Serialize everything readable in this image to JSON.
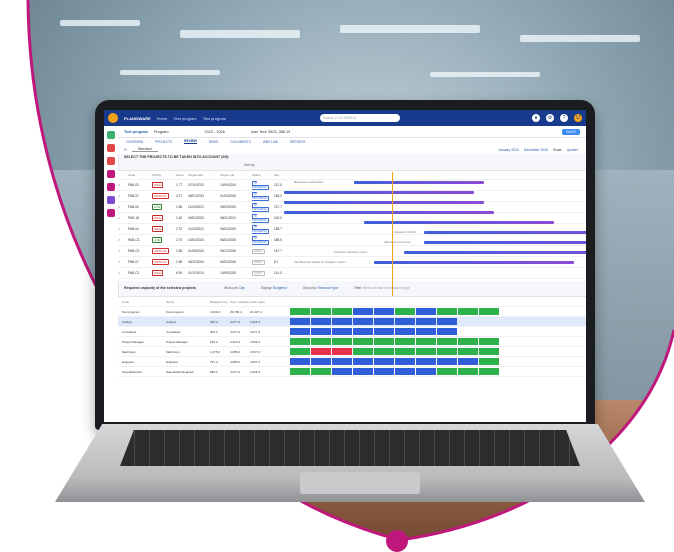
{
  "app": {
    "brand": "PLANISWARE",
    "brand_sub": "Enterprise",
    "crumbs": [
      "Home",
      "Test program",
      "Test program"
    ],
    "search_placeholder": "Search (Ctrl+Shift+K)"
  },
  "project_bar": {
    "name": "Test program",
    "type": "Program",
    "range": "2023 - 2026",
    "owner": "Ivan Tech 3523_388 19",
    "save_label": "SAVE"
  },
  "tabs": [
    "OVERVIEW",
    "PROJECTS",
    "REVIEW",
    "RISKS",
    "DOCUMENTS",
    "WBS LINK",
    "REPORTS"
  ],
  "active_tab": "REVIEW",
  "filter": {
    "label": "Standard",
    "sort_label": "Sort by",
    "scale_label": "Scale",
    "scale_value": "Quarter",
    "from_label": "January 2023",
    "to_label": "December 2026"
  },
  "selector_title": "SELECT THE PROJECTS TO BE TAKEN INTO ACCOUNT (2/9)",
  "grid_headers": [
    "Code",
    "Priority",
    "Score",
    "Target start",
    "Target end",
    "Status",
    "Slot"
  ],
  "projects": [
    {
      "code": "PAB-03",
      "priority": "HIGH",
      "pclass": "prio-high",
      "score": "1.77",
      "start": "07/10/2023",
      "end": "10/09/2024",
      "status": "IN PROGRESS",
      "sclass": "",
      "slot": "112.0"
    },
    {
      "code": "PAB-01",
      "priority": "CRITICAL",
      "pclass": "prio-critical",
      "score": "2.27",
      "start": "06/01/2023",
      "end": "01/04/2026",
      "status": "IN PROGRESS",
      "sclass": "",
      "slot": "183.0"
    },
    {
      "code": "PAB-06",
      "priority": "LOW",
      "pclass": "prio-low",
      "score": "1.68",
      "start": "11/04/2023",
      "end": "09/03/2025",
      "status": "IN PROGRESS",
      "sclass": "",
      "slot": "227.7"
    },
    {
      "code": "PAB-18",
      "priority": "HIGH",
      "pclass": "prio-high",
      "score": "1.62",
      "start": "09/02/2023",
      "end": "08/11/2024",
      "status": "IN PROGRESS",
      "sclass": "",
      "slot": "242.0"
    },
    {
      "code": "PAB-04",
      "priority": "HIGH",
      "pclass": "prio-high",
      "score": "2.70",
      "start": "11/03/2023",
      "end": "05/04/2025",
      "status": "IN PROGRESS",
      "sclass": "",
      "slot": "188.7"
    },
    {
      "code": "PAB-C3",
      "priority": "LOW",
      "pclass": "prio-low",
      "score": "2.70",
      "start": "10/04/2024",
      "end": "06/03/2026",
      "status": "IN PROGRESS",
      "sclass": "",
      "slot": "185.6"
    },
    {
      "code": "PAB-C0",
      "priority": "CRITICAL",
      "pclass": "prio-critical",
      "score": "1.85",
      "start": "01/08/2024",
      "end": "09/12/2026",
      "status": "DRAFT",
      "sclass": "status-draft",
      "slot": "167.7"
    },
    {
      "code": "PAB-07",
      "priority": "CRITICAL",
      "pclass": "prio-critical",
      "score": "1.58",
      "start": "05/10/2024",
      "end": "04/02/2026",
      "status": "DRAFT",
      "sclass": "status-draft",
      "slot": "8.7"
    },
    {
      "code": "PAB-C2",
      "priority": "HIGH",
      "pclass": "prio-high",
      "score": "6.90",
      "start": "01/11/2024",
      "end": "10/05/2025",
      "status": "DRAFT",
      "sclass": "status-draft",
      "slot": "114.0"
    }
  ],
  "gantt_labels": [
    "Maintenance optimisation",
    "Integration of AI/LS",
    "data cloud environment",
    "Supersonic planetary system",
    "New Bluetooth adaptor for navigation system"
  ],
  "capacity": {
    "title": "Required capacity of the selected projects",
    "work_unit_label": "Work unit",
    "work_unit_value": "Day",
    "display_label": "Display",
    "display_value": "Budgeted",
    "group_label": "Group by",
    "group_value": "Resource type",
    "filter_label": "Filter",
    "filter_placeholder": "Select at least one resource type",
    "headers": [
      "Code",
      "Name",
      "Budgeted wo",
      "Prior. capacity",
      "Avail. capa"
    ],
    "rows": [
      {
        "code": "Test program",
        "name": "Test program",
        "b": "4,039 d",
        "p": "35,786 d",
        "a": "24,407 d",
        "cells": [
          "green",
          "green",
          "green",
          "blue",
          "blue",
          "green",
          "blue",
          "green",
          "green",
          "green"
        ],
        "sel": false
      },
      {
        "code": "Analyst",
        "name": "Analyst",
        "b": "339 d",
        "p": "4,077 d",
        "a": "3,325 d",
        "cells": [
          "blue",
          "blue",
          "blue",
          "blue",
          "blue",
          "blue",
          "blue",
          "blue",
          "none",
          "none"
        ],
        "sel": true
      },
      {
        "code": "Consultant",
        "name": "Consultant",
        "b": "305 d",
        "p": "4,077 d",
        "a": "4,477 d",
        "cells": [
          "blue",
          "blue",
          "blue",
          "blue",
          "blue",
          "blue",
          "blue",
          "blue",
          "none",
          "none"
        ],
        "sel": false
      },
      {
        "code": "Project Manager",
        "name": "Project Manager",
        "b": "155 d",
        "p": "2,330 d",
        "a": "2,066 d",
        "cells": [
          "green",
          "green",
          "green",
          "green",
          "green",
          "green",
          "green",
          "green",
          "green",
          "green"
        ],
        "sel": false
      },
      {
        "code": "Machinery",
        "name": "Machinery",
        "b": "1,275 d",
        "p": "4,085 d",
        "a": "2,537 d",
        "cells": [
          "green",
          "red",
          "red",
          "green",
          "green",
          "green",
          "green",
          "green",
          "green",
          "green"
        ],
        "sel": false
      },
      {
        "code": "Engineer",
        "name": "Engineer",
        "b": "791 d",
        "p": "4,085 d",
        "a": "4,537 d",
        "cells": [
          "blue",
          "blue",
          "blue",
          "blue",
          "blue",
          "blue",
          "blue",
          "blue",
          "blue",
          "green"
        ],
        "sel": false
      },
      {
        "code": "Specialized En...",
        "name": "Specialized Engineer",
        "b": "589 d",
        "p": "4,077 d",
        "a": "3,425 d",
        "cells": [
          "green",
          "green",
          "blue",
          "blue",
          "blue",
          "blue",
          "blue",
          "green",
          "green",
          "green"
        ],
        "sel": false
      }
    ]
  },
  "colors": {
    "brand_blue": "#173a8c",
    "accent_magenta": "#c0177c",
    "heat_green": "#2db14a",
    "heat_blue": "#2f5ed8",
    "heat_red": "#e5324a"
  }
}
